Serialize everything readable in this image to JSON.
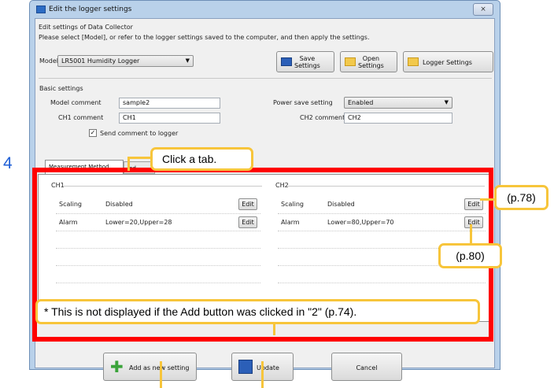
{
  "window": {
    "title": "Edit the logger settings",
    "close": "⨯"
  },
  "header": {
    "line1": "Edit settings of Data Collector",
    "line2": "Please select [Model], or refer to the logger settings saved to the computer, and then apply the settings."
  },
  "model": {
    "label": "Model",
    "value": "LR5001 Humidity Logger"
  },
  "toolbar": {
    "save_l1": "Save",
    "save_l2": "Settings",
    "open_l1": "Open",
    "open_l2": "Settings",
    "logger": "Logger Settings"
  },
  "basic": {
    "heading": "Basic settings",
    "model_comment_label": "Model comment",
    "model_comment_value": "sample2",
    "ch1_comment_label": "CH1 comment",
    "ch1_comment_value": "CH1",
    "send_comment": "Send comment to logger",
    "power_save_label": "Power save setting",
    "power_save_value": "Enabled",
    "ch2_comment_label": "CH2 comment",
    "ch2_comment_value": "CH2"
  },
  "tabs": {
    "measurement": "Measurement Method",
    "other_partial": "Ind"
  },
  "ch1": {
    "title": "CH1",
    "rows": [
      {
        "name": "Scaling",
        "value": "Disabled",
        "btn": "Edit"
      },
      {
        "name": "Alarm",
        "value": "Lower=20,Upper=28",
        "btn": "Edit"
      }
    ]
  },
  "ch2": {
    "title": "CH2",
    "rows": [
      {
        "name": "Scaling",
        "value": "Disabled",
        "btn": "Edit"
      },
      {
        "name": "Alarm",
        "value": "Lower=80,Upper=70",
        "btn": "Edit"
      }
    ]
  },
  "bottom": {
    "add": "Add as new setting",
    "update": "Update",
    "cancel": "Cancel"
  },
  "annotations": {
    "step": "4",
    "click_tab": "Click a tab.",
    "p78": "(p.78)",
    "p80": "(p.80)",
    "note": "* This is not displayed if the Add button was clicked in \"2\" (p.74)."
  },
  "colors": {
    "highlight": "#ff0000",
    "callout_border": "#f7c53b",
    "step_number": "#1f5fd6"
  }
}
